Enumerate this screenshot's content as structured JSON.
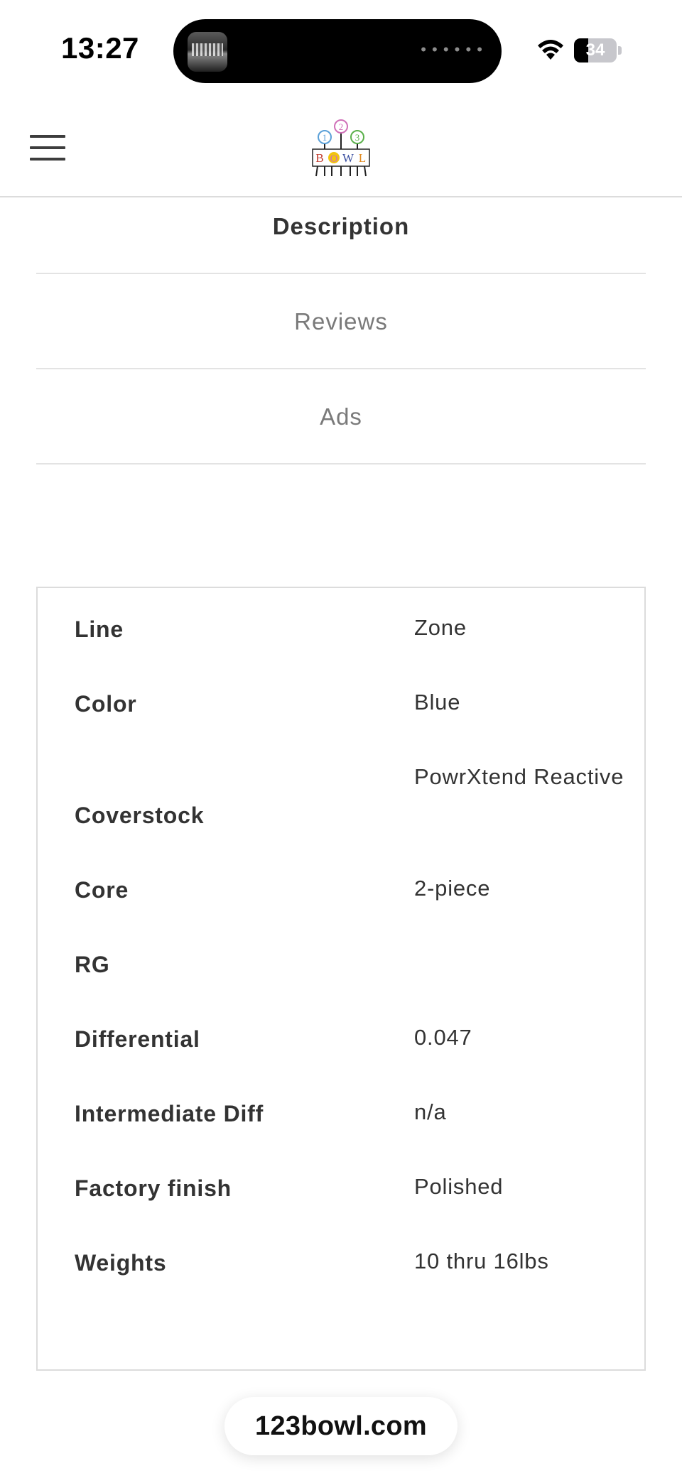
{
  "status_bar": {
    "time": "13:27",
    "island_dots": "• • • • • •",
    "battery_level": 34,
    "battery_text": "34"
  },
  "header": {
    "menu_icon": "hamburger-menu-icon",
    "logo": {
      "letters": [
        "B",
        "O",
        "W",
        "L"
      ],
      "numbers": [
        "1",
        "2",
        "3"
      ]
    }
  },
  "tabs": [
    {
      "label": "Description",
      "active": true
    },
    {
      "label": "Reviews",
      "active": false
    },
    {
      "label": "Ads",
      "active": false
    }
  ],
  "specs": [
    {
      "label": "Line",
      "value": "Zone"
    },
    {
      "label": "Color",
      "value": "Blue"
    },
    {
      "label": "Coverstock",
      "value": "PowrXtend Reactive"
    },
    {
      "label": "Core",
      "value": "2-piece"
    },
    {
      "label": "RG",
      "value": ""
    },
    {
      "label": "Differential",
      "value": "0.047"
    },
    {
      "label": "Intermediate Diff",
      "value": "n/a"
    },
    {
      "label": "Factory finish",
      "value": "Polished"
    },
    {
      "label": "Weights",
      "value": "10 thru 16lbs"
    }
  ],
  "footer": {
    "url": "123bowl.com"
  },
  "colors": {
    "text": "#333333",
    "muted": "#7a7a7a",
    "divider": "#e3e3e3",
    "logo_pink": "#d070b8",
    "logo_blue": "#5aa0d8",
    "logo_green": "#5ab04a"
  }
}
